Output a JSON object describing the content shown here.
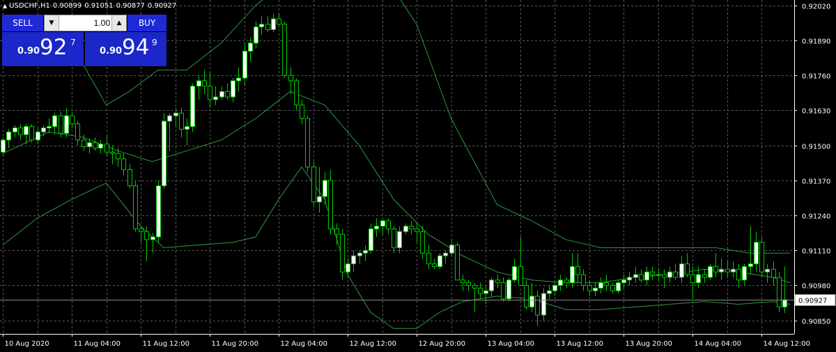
{
  "header": {
    "symbol": "USDCHF,H1",
    "open": "0.90899",
    "high": "0.91051",
    "low": "0.90877",
    "close": "0.90927"
  },
  "trade_panel": {
    "sell_label": "SELL",
    "buy_label": "BUY",
    "lot_value": "1.00",
    "sell_price": {
      "prefix": "0.90",
      "big": "92",
      "sup": "7"
    },
    "buy_price": {
      "prefix": "0.90",
      "big": "94",
      "sup": "9"
    }
  },
  "colors": {
    "background": "#000000",
    "grid": "#5a5a5a",
    "bull": "#ffffff",
    "bear": "#000000",
    "wick": "#00cc00",
    "indicator": "#2e9a3c",
    "price_line": "#8a8a8a",
    "text": "#ffffff",
    "panel_blue": "#1f2ad6"
  },
  "chart_data": {
    "type": "candlestick",
    "symbol": "USDCHF",
    "timeframe": "H1",
    "ylim": [
      0.908,
      0.9204
    ],
    "y_ticks": [
      "0.92020",
      "0.91890",
      "0.91760",
      "0.91630",
      "0.91500",
      "0.91370",
      "0.91240",
      "0.91110",
      "0.90980",
      "0.90850"
    ],
    "x_ticks": [
      "10 Aug 2020",
      "11 Aug 04:00",
      "11 Aug 12:00",
      "11 Aug 20:00",
      "12 Aug 04:00",
      "12 Aug 12:00",
      "12 Aug 20:00",
      "13 Aug 04:00",
      "13 Aug 12:00",
      "13 Aug 20:00",
      "14 Aug 04:00",
      "14 Aug 12:00"
    ],
    "x_tick_positions": [
      0,
      12,
      24,
      36,
      48,
      60,
      72,
      84,
      96,
      108,
      120,
      132
    ],
    "current_price": "0.90927",
    "grid": true,
    "candles": [
      [
        0.91475,
        0.9153,
        0.9146,
        0.9152
      ],
      [
        0.9152,
        0.9156,
        0.9149,
        0.9155
      ],
      [
        0.9155,
        0.91575,
        0.9153,
        0.91565
      ],
      [
        0.91565,
        0.9158,
        0.9152,
        0.9154
      ],
      [
        0.9154,
        0.9158,
        0.91505,
        0.9157
      ],
      [
        0.9157,
        0.9158,
        0.9151,
        0.9152
      ],
      [
        0.9152,
        0.91565,
        0.91505,
        0.9155
      ],
      [
        0.9155,
        0.91575,
        0.91535,
        0.91565
      ],
      [
        0.91565,
        0.916,
        0.91545,
        0.9157
      ],
      [
        0.9157,
        0.9162,
        0.9154,
        0.9161
      ],
      [
        0.9161,
        0.91625,
        0.9153,
        0.91545
      ],
      [
        0.91545,
        0.9164,
        0.9153,
        0.9161
      ],
      [
        0.9161,
        0.91625,
        0.91565,
        0.9158
      ],
      [
        0.9158,
        0.9159,
        0.915,
        0.9152
      ],
      [
        0.9152,
        0.9154,
        0.9148,
        0.91495
      ],
      [
        0.91495,
        0.91525,
        0.9147,
        0.9151
      ],
      [
        0.9151,
        0.9153,
        0.9148,
        0.9149
      ],
      [
        0.9149,
        0.9152,
        0.9147,
        0.91505
      ],
      [
        0.91505,
        0.91535,
        0.9146,
        0.91475
      ],
      [
        0.91475,
        0.915,
        0.9143,
        0.9147
      ],
      [
        0.9147,
        0.9149,
        0.9142,
        0.9145
      ],
      [
        0.9145,
        0.9147,
        0.9139,
        0.9141
      ],
      [
        0.9141,
        0.9143,
        0.9134,
        0.9135
      ],
      [
        0.9135,
        0.9137,
        0.9118,
        0.9119
      ],
      [
        0.9119,
        0.912,
        0.9114,
        0.9118
      ],
      [
        0.9118,
        0.912,
        0.9107,
        0.9115
      ],
      [
        0.9115,
        0.91175,
        0.911,
        0.9116
      ],
      [
        0.9116,
        0.9137,
        0.9114,
        0.9135
      ],
      [
        0.9135,
        0.9162,
        0.9134,
        0.9159
      ],
      [
        0.9159,
        0.9162,
        0.9148,
        0.9161
      ],
      [
        0.9161,
        0.9164,
        0.9157,
        0.9162
      ],
      [
        0.9162,
        0.9164,
        0.9153,
        0.9156
      ],
      [
        0.9156,
        0.916,
        0.915,
        0.9157
      ],
      [
        0.9157,
        0.9173,
        0.9155,
        0.9172
      ],
      [
        0.9172,
        0.9176,
        0.9167,
        0.9174
      ],
      [
        0.9174,
        0.9178,
        0.9169,
        0.9172
      ],
      [
        0.9172,
        0.9177,
        0.9164,
        0.9167
      ],
      [
        0.9167,
        0.9172,
        0.9165,
        0.9168
      ],
      [
        0.9168,
        0.9172,
        0.9167,
        0.917
      ],
      [
        0.917,
        0.9173,
        0.9167,
        0.9168
      ],
      [
        0.9168,
        0.9175,
        0.9166,
        0.9174
      ],
      [
        0.9174,
        0.9179,
        0.917,
        0.9175
      ],
      [
        0.9175,
        0.9188,
        0.9172,
        0.9185
      ],
      [
        0.9185,
        0.919,
        0.9181,
        0.9188
      ],
      [
        0.9188,
        0.9196,
        0.9186,
        0.9194
      ],
      [
        0.9194,
        0.9198,
        0.9191,
        0.9195
      ],
      [
        0.9195,
        0.9198,
        0.9192,
        0.9193
      ],
      [
        0.9193,
        0.9199,
        0.9192,
        0.9197
      ],
      [
        0.9197,
        0.9199,
        0.9194,
        0.9195
      ],
      [
        0.9195,
        0.9196,
        0.9175,
        0.9176
      ],
      [
        0.9176,
        0.9179,
        0.9169,
        0.9174
      ],
      [
        0.9174,
        0.9175,
        0.9163,
        0.9165
      ],
      [
        0.9165,
        0.9167,
        0.9158,
        0.916
      ],
      [
        0.916,
        0.9161,
        0.914,
        0.9142
      ],
      [
        0.9142,
        0.9144,
        0.9127,
        0.9129
      ],
      [
        0.9129,
        0.9142,
        0.9125,
        0.9131
      ],
      [
        0.9131,
        0.914,
        0.9128,
        0.9137
      ],
      [
        0.9137,
        0.9141,
        0.9117,
        0.9119
      ],
      [
        0.9119,
        0.9121,
        0.9113,
        0.9117
      ],
      [
        0.9117,
        0.9119,
        0.91,
        0.9103
      ],
      [
        0.9103,
        0.9108,
        0.9102,
        0.9106
      ],
      [
        0.9106,
        0.9111,
        0.9103,
        0.9109
      ],
      [
        0.9109,
        0.9111,
        0.9106,
        0.911
      ],
      [
        0.911,
        0.9113,
        0.9107,
        0.9111
      ],
      [
        0.9111,
        0.9121,
        0.911,
        0.9119
      ],
      [
        0.9119,
        0.9123,
        0.9116,
        0.912
      ],
      [
        0.912,
        0.9123,
        0.9117,
        0.9122
      ],
      [
        0.9122,
        0.9123,
        0.9117,
        0.9119
      ],
      [
        0.9119,
        0.912,
        0.911,
        0.9112
      ],
      [
        0.9112,
        0.912,
        0.911,
        0.9118
      ],
      [
        0.9118,
        0.9121,
        0.9117,
        0.912
      ],
      [
        0.912,
        0.9122,
        0.9117,
        0.9119
      ],
      [
        0.9119,
        0.9121,
        0.9114,
        0.9118
      ],
      [
        0.9118,
        0.912,
        0.9108,
        0.911
      ],
      [
        0.911,
        0.9113,
        0.9104,
        0.9106
      ],
      [
        0.9106,
        0.9108,
        0.9104,
        0.9105
      ],
      [
        0.9105,
        0.911,
        0.9104,
        0.9109
      ],
      [
        0.9109,
        0.9111,
        0.9106,
        0.911
      ],
      [
        0.911,
        0.9115,
        0.9109,
        0.9113
      ],
      [
        0.9113,
        0.9114,
        0.91,
        0.91
      ],
      [
        0.91,
        0.9102,
        0.9096,
        0.9099
      ],
      [
        0.9099,
        0.91,
        0.9096,
        0.9098
      ],
      [
        0.9098,
        0.9099,
        0.9088,
        0.9097
      ],
      [
        0.9097,
        0.9099,
        0.9093,
        0.9095
      ],
      [
        0.9095,
        0.9098,
        0.9091,
        0.9096
      ],
      [
        0.9096,
        0.9101,
        0.9094,
        0.91
      ],
      [
        0.91,
        0.9102,
        0.9097,
        0.9099
      ],
      [
        0.9099,
        0.9101,
        0.9092,
        0.9093
      ],
      [
        0.9093,
        0.9101,
        0.9092,
        0.91
      ],
      [
        0.91,
        0.9108,
        0.9099,
        0.9105
      ],
      [
        0.9105,
        0.9116,
        0.9099,
        0.9098
      ],
      [
        0.9098,
        0.91,
        0.9089,
        0.909
      ],
      [
        0.909,
        0.9099,
        0.9088,
        0.9094
      ],
      [
        0.9094,
        0.9096,
        0.9083,
        0.9087
      ],
      [
        0.9087,
        0.9097,
        0.9085,
        0.9095
      ],
      [
        0.9095,
        0.9098,
        0.9093,
        0.9096
      ],
      [
        0.9096,
        0.9099,
        0.9094,
        0.9098
      ],
      [
        0.9098,
        0.9102,
        0.9096,
        0.91
      ],
      [
        0.91,
        0.9101,
        0.9097,
        0.9099
      ],
      [
        0.9099,
        0.911,
        0.9097,
        0.9105
      ],
      [
        0.9105,
        0.911,
        0.9099,
        0.9102
      ],
      [
        0.9102,
        0.9104,
        0.9096,
        0.9098
      ],
      [
        0.9098,
        0.91,
        0.9094,
        0.9096
      ],
      [
        0.9096,
        0.9099,
        0.9094,
        0.9097
      ],
      [
        0.9097,
        0.9101,
        0.9095,
        0.9099
      ],
      [
        0.9099,
        0.9102,
        0.9096,
        0.9098
      ],
      [
        0.9098,
        0.9099,
        0.9095,
        0.9096
      ],
      [
        0.9096,
        0.91,
        0.9095,
        0.9099
      ],
      [
        0.9099,
        0.9102,
        0.9097,
        0.91
      ],
      [
        0.91,
        0.9103,
        0.9098,
        0.9101
      ],
      [
        0.9101,
        0.9105,
        0.9099,
        0.9102
      ],
      [
        0.9102,
        0.9104,
        0.9099,
        0.91
      ],
      [
        0.91,
        0.9105,
        0.9098,
        0.9103
      ],
      [
        0.9103,
        0.9105,
        0.91,
        0.9102
      ],
      [
        0.9102,
        0.9104,
        0.91,
        0.9102
      ],
      [
        0.9102,
        0.9104,
        0.9097,
        0.9101
      ],
      [
        0.9101,
        0.9105,
        0.9099,
        0.9103
      ],
      [
        0.9103,
        0.9106,
        0.91,
        0.9101
      ],
      [
        0.9101,
        0.9109,
        0.9099,
        0.9106
      ],
      [
        0.9106,
        0.911,
        0.9101,
        0.9102
      ],
      [
        0.9102,
        0.9105,
        0.9093,
        0.9099
      ],
      [
        0.9099,
        0.9105,
        0.9097,
        0.9102
      ],
      [
        0.9102,
        0.9104,
        0.9099,
        0.9101
      ],
      [
        0.9101,
        0.9106,
        0.91,
        0.9105
      ],
      [
        0.9105,
        0.911,
        0.9101,
        0.9103
      ],
      [
        0.9103,
        0.9108,
        0.91,
        0.9104
      ],
      [
        0.9104,
        0.9107,
        0.9101,
        0.9103
      ],
      [
        0.9103,
        0.9107,
        0.9101,
        0.9104
      ],
      [
        0.9104,
        0.9106,
        0.9097,
        0.91
      ],
      [
        0.91,
        0.9106,
        0.9098,
        0.9105
      ],
      [
        0.9105,
        0.912,
        0.9102,
        0.9106
      ],
      [
        0.9106,
        0.9118,
        0.9103,
        0.9114
      ],
      [
        0.9114,
        0.9116,
        0.9101,
        0.9103
      ],
      [
        0.9103,
        0.9106,
        0.9099,
        0.9104
      ],
      [
        0.9104,
        0.9107,
        0.9098,
        0.9101
      ],
      [
        0.9101,
        0.9103,
        0.9088,
        0.909
      ],
      [
        0.909,
        0.9105,
        0.90877,
        0.90927
      ]
    ],
    "band_upper": [
      [
        0,
        0.9183
      ],
      [
        8,
        0.9185
      ],
      [
        14,
        0.918
      ],
      [
        18,
        0.9165
      ],
      [
        22,
        0.917
      ],
      [
        27,
        0.9178
      ],
      [
        32,
        0.9178
      ],
      [
        38,
        0.9188
      ],
      [
        44,
        0.9202
      ],
      [
        50,
        0.9212
      ],
      [
        56,
        0.9212
      ],
      [
        62,
        0.9212
      ],
      [
        68,
        0.9208
      ],
      [
        72,
        0.9195
      ],
      [
        78,
        0.916
      ],
      [
        86,
        0.9128
      ],
      [
        92,
        0.9122
      ],
      [
        98,
        0.9115
      ],
      [
        104,
        0.9112
      ],
      [
        112,
        0.9112
      ],
      [
        118,
        0.9112
      ],
      [
        124,
        0.9112
      ],
      [
        130,
        0.911
      ],
      [
        137,
        0.911
      ]
    ],
    "band_middle": [
      [
        0,
        0.9147
      ],
      [
        8,
        0.9155
      ],
      [
        14,
        0.9153
      ],
      [
        20,
        0.9148
      ],
      [
        26,
        0.9144
      ],
      [
        32,
        0.9148
      ],
      [
        38,
        0.9152
      ],
      [
        44,
        0.916
      ],
      [
        50,
        0.917
      ],
      [
        56,
        0.9165
      ],
      [
        62,
        0.915
      ],
      [
        68,
        0.913
      ],
      [
        74,
        0.9117
      ],
      [
        80,
        0.9109
      ],
      [
        86,
        0.9103
      ],
      [
        92,
        0.91
      ],
      [
        98,
        0.9099
      ],
      [
        104,
        0.9099
      ],
      [
        110,
        0.9101
      ],
      [
        116,
        0.9102
      ],
      [
        122,
        0.9104
      ],
      [
        128,
        0.9103
      ],
      [
        134,
        0.9101
      ],
      [
        137,
        0.9099
      ]
    ],
    "band_lower": [
      [
        0,
        0.9113
      ],
      [
        6,
        0.9123
      ],
      [
        12,
        0.913
      ],
      [
        18,
        0.9136
      ],
      [
        24,
        0.912
      ],
      [
        28,
        0.9112
      ],
      [
        34,
        0.9113
      ],
      [
        40,
        0.9114
      ],
      [
        44,
        0.9116
      ],
      [
        48,
        0.913
      ],
      [
        52,
        0.9142
      ],
      [
        56,
        0.913
      ],
      [
        60,
        0.9102
      ],
      [
        64,
        0.9088
      ],
      [
        68,
        0.9082
      ],
      [
        72,
        0.9082
      ],
      [
        76,
        0.9088
      ],
      [
        80,
        0.9092
      ],
      [
        86,
        0.9094
      ],
      [
        92,
        0.9093
      ],
      [
        98,
        0.9089
      ],
      [
        104,
        0.9089
      ],
      [
        110,
        0.909
      ],
      [
        116,
        0.9091
      ],
      [
        122,
        0.9092
      ],
      [
        128,
        0.9091
      ],
      [
        134,
        0.9092
      ],
      [
        137,
        0.9091
      ]
    ]
  }
}
